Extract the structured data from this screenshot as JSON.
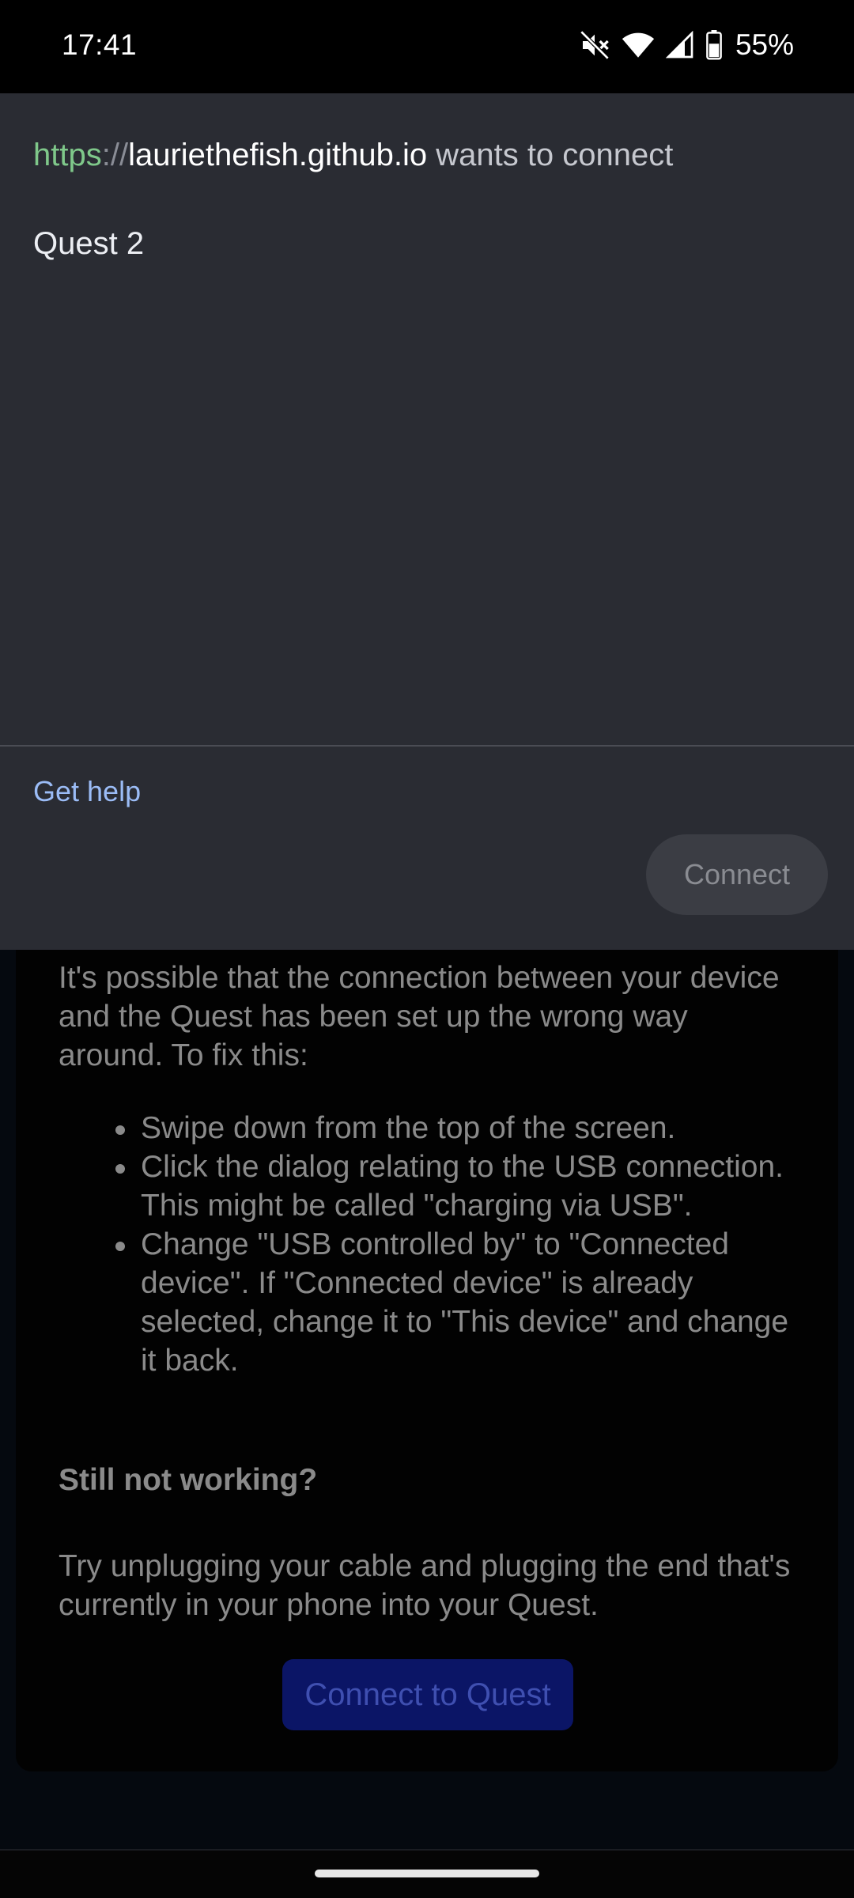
{
  "status_bar": {
    "time": "17:41",
    "battery_percent": "55%",
    "icons": [
      "mute-icon",
      "wifi-icon",
      "signal-icon",
      "battery-icon"
    ]
  },
  "dialog": {
    "origin_scheme": "https",
    "origin_separator": "://",
    "origin_host": "lauriethefish.github.io",
    "origin_suffix": " wants to connect",
    "device_name": "Quest 2",
    "get_help_label": "Get help",
    "connect_label": "Connect"
  },
  "background_page": {
    "intro": "It's possible that the connection between your device and the Quest has been set up the wrong way around. To fix this:",
    "steps": [
      "Swipe down from the top of the screen.",
      "Click the dialog relating to the USB connection. This might be called \"charging via USB\".",
      "Change \"USB controlled by\" to \"Connected device\". If \"Connected device\" is already selected, change it to \"This device\" and change it back."
    ],
    "still_heading": "Still not working?",
    "still_text": "Try unplugging your cable and plugging the end that's currently in your phone into your Quest.",
    "connect_button_label": "Connect to Quest"
  },
  "colors": {
    "dialog_bg": "#2a2c33",
    "link": "#9bbcf6",
    "scheme_green": "#7fc88a",
    "quest_button": "#0b1566"
  }
}
